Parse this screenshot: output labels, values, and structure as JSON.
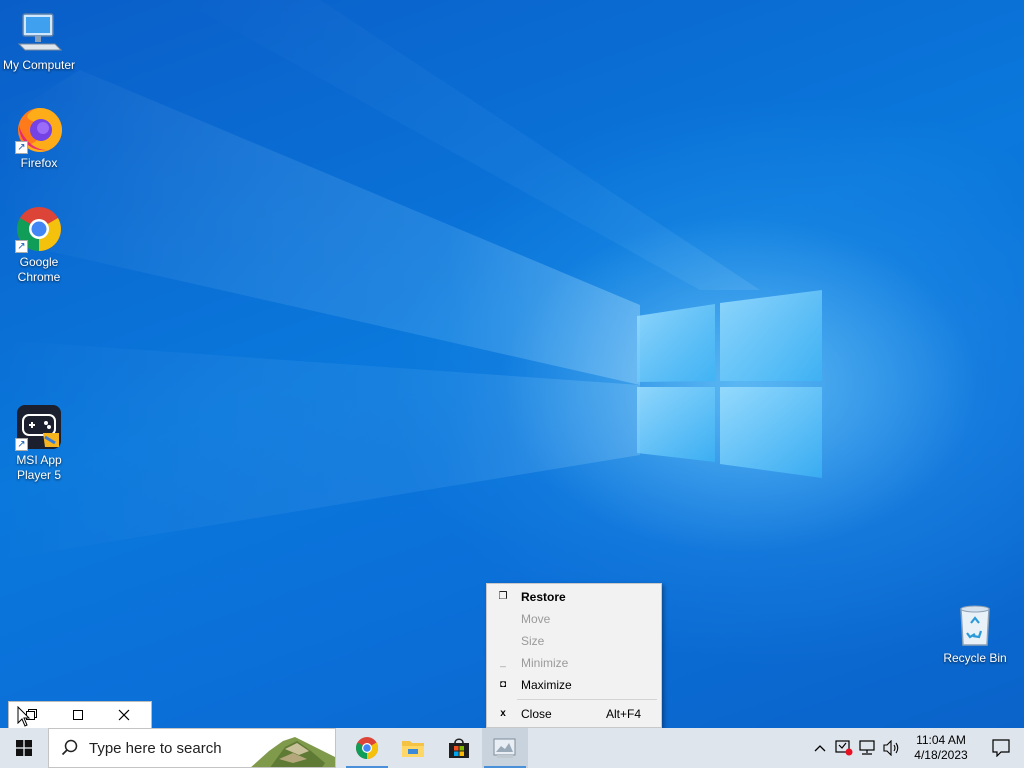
{
  "desktop_icons": [
    {
      "label": "My Computer",
      "icon": "computer-icon",
      "shortcut": false
    },
    {
      "label": "Firefox",
      "icon": "firefox-icon",
      "shortcut": true
    },
    {
      "label": "Google Chrome",
      "icon": "chrome-icon",
      "shortcut": true
    },
    {
      "label": "MSI App Player 5",
      "icon": "msi-app-player-icon",
      "shortcut": true
    },
    {
      "label": "Recycle Bin",
      "icon": "recycle-bin-icon",
      "shortcut": false
    }
  ],
  "minimized_window": {
    "buttons": [
      "restore-icon",
      "maximize-icon",
      "close-icon"
    ]
  },
  "context_menu": {
    "items": [
      {
        "label": "Restore",
        "glyph": "restore-icon",
        "enabled": true,
        "bold": true,
        "accelerator": ""
      },
      {
        "label": "Move",
        "glyph": "",
        "enabled": false,
        "bold": false,
        "accelerator": ""
      },
      {
        "label": "Size",
        "glyph": "",
        "enabled": false,
        "bold": false,
        "accelerator": ""
      },
      {
        "label": "Minimize",
        "glyph": "minimize-icon",
        "enabled": false,
        "bold": false,
        "accelerator": ""
      },
      {
        "label": "Maximize",
        "glyph": "maximize-icon",
        "enabled": true,
        "bold": false,
        "accelerator": ""
      },
      {
        "label": "Close",
        "glyph": "close-icon",
        "enabled": true,
        "bold": false,
        "accelerator": "Alt+F4"
      }
    ]
  },
  "taskbar": {
    "search_placeholder": "Type here to search",
    "pinned_apps": [
      {
        "icon": "chrome-icon",
        "running": true,
        "active": false
      },
      {
        "icon": "file-explorer-icon",
        "running": false,
        "active": false
      },
      {
        "icon": "microsoft-store-icon",
        "running": false,
        "active": false
      },
      {
        "icon": "app-window-icon",
        "running": true,
        "active": true
      }
    ],
    "tray_icons": [
      "chevron-up-icon",
      "security-alert-icon",
      "network-icon",
      "volume-icon"
    ],
    "clock": {
      "time": "11:04 AM",
      "date": "4/18/2023"
    }
  },
  "colors": {
    "desktop": "#0a78dc",
    "taskbar": "#dfe5ec",
    "menu": "#f2f2f2",
    "disabled_text": "#9a9a9a"
  }
}
